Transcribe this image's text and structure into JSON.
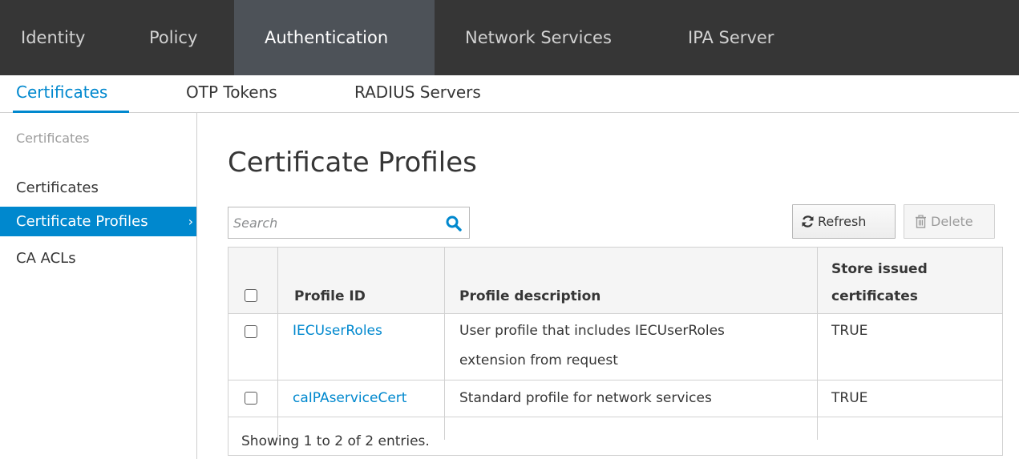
{
  "top_nav": {
    "tabs": [
      "Identity",
      "Policy",
      "Authentication",
      "Network Services",
      "IPA Server"
    ],
    "active": "Authentication"
  },
  "sub_nav": {
    "tabs": [
      "Certificates",
      "OTP Tokens",
      "RADIUS Servers"
    ],
    "active": "Certificates"
  },
  "sidebar": {
    "heading": "Certificates",
    "items": [
      "Certificates",
      "Certificate Profiles",
      "CA ACLs"
    ],
    "active": "Certificate Profiles",
    "chevron": "›"
  },
  "main": {
    "title": "Certificate Profiles",
    "search_placeholder": "Search",
    "search_value": "",
    "refresh_label": "Refresh",
    "delete_label": "Delete"
  },
  "table": {
    "columns": [
      "Profile ID",
      "Profile description",
      "Store issued certificates"
    ],
    "column_header_line1": "Store issued",
    "column_header_line2": "certificates",
    "rows": [
      {
        "profile_id": "IECUserRoles",
        "description_line1": "User profile that includes IECUserRoles",
        "description_line2": "extension from request",
        "store": "TRUE"
      },
      {
        "profile_id": "caIPAserviceCert",
        "description_line1": "Standard profile for network services",
        "description_line2": "",
        "store": "TRUE"
      }
    ],
    "footer": "Showing 1 to 2 of 2 entries."
  },
  "colors": {
    "topnav_bg": "#363636",
    "topnav_active_bg": "#4d5258",
    "accent": "#0088ce",
    "border": "#d1d1d1"
  },
  "icons": {
    "search": "search-icon",
    "refresh": "refresh-icon",
    "delete": "trash-icon"
  }
}
